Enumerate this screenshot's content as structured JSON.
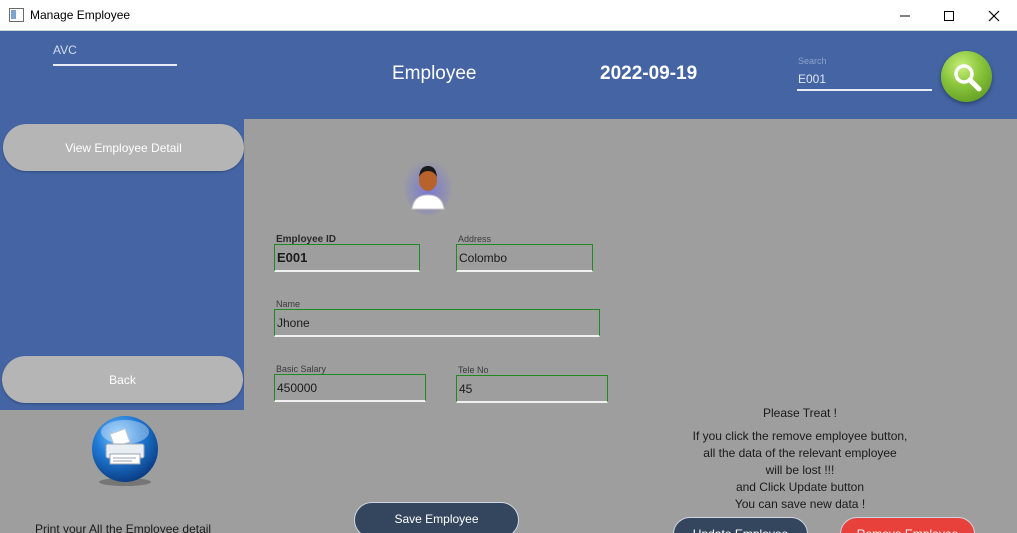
{
  "window": {
    "title": "Manage Employee",
    "controls": {
      "minimize_icon": "minimize-icon",
      "maximize_icon": "maximize-icon",
      "close_icon": "close-icon"
    }
  },
  "header": {
    "avc_label": "AVC",
    "title": "Employee",
    "date": "2022-09-19",
    "search": {
      "label": "Search",
      "value": "E001",
      "icon": "search-icon"
    },
    "color": "#4464a4"
  },
  "sidebar": {
    "view_button": "View Employee Detail",
    "back_button": "Back",
    "print_icon": "printer-icon",
    "print_text": "Print your All the Employee detail"
  },
  "form": {
    "avatar_icon": "user-avatar-icon",
    "employee_id": {
      "label": "Employee ID",
      "value": "E001"
    },
    "address": {
      "label": "Address",
      "value": "Colombo"
    },
    "name": {
      "label": "Name",
      "value": "Jhone"
    },
    "basic_salary": {
      "label": "Basic Salary",
      "value": "450000"
    },
    "tele_no": {
      "label": "Tele No",
      "value": "45"
    },
    "save_button": "Save Employee"
  },
  "notice": {
    "heading": "Please Treat !",
    "line1": "If you click the remove employee button,",
    "line2": "all the data of the relevant employee",
    "line3": "will be lost !!!",
    "line4": "and Click Update button",
    "line5": "You can save new data !"
  },
  "actions": {
    "update_button": "Update Employee",
    "remove_button": "Remove Employee"
  },
  "colors": {
    "field_border": "#1f8a1f",
    "dark_button": "#33465e",
    "danger_button": "#e8413b",
    "search_button": "#8dc73f"
  }
}
